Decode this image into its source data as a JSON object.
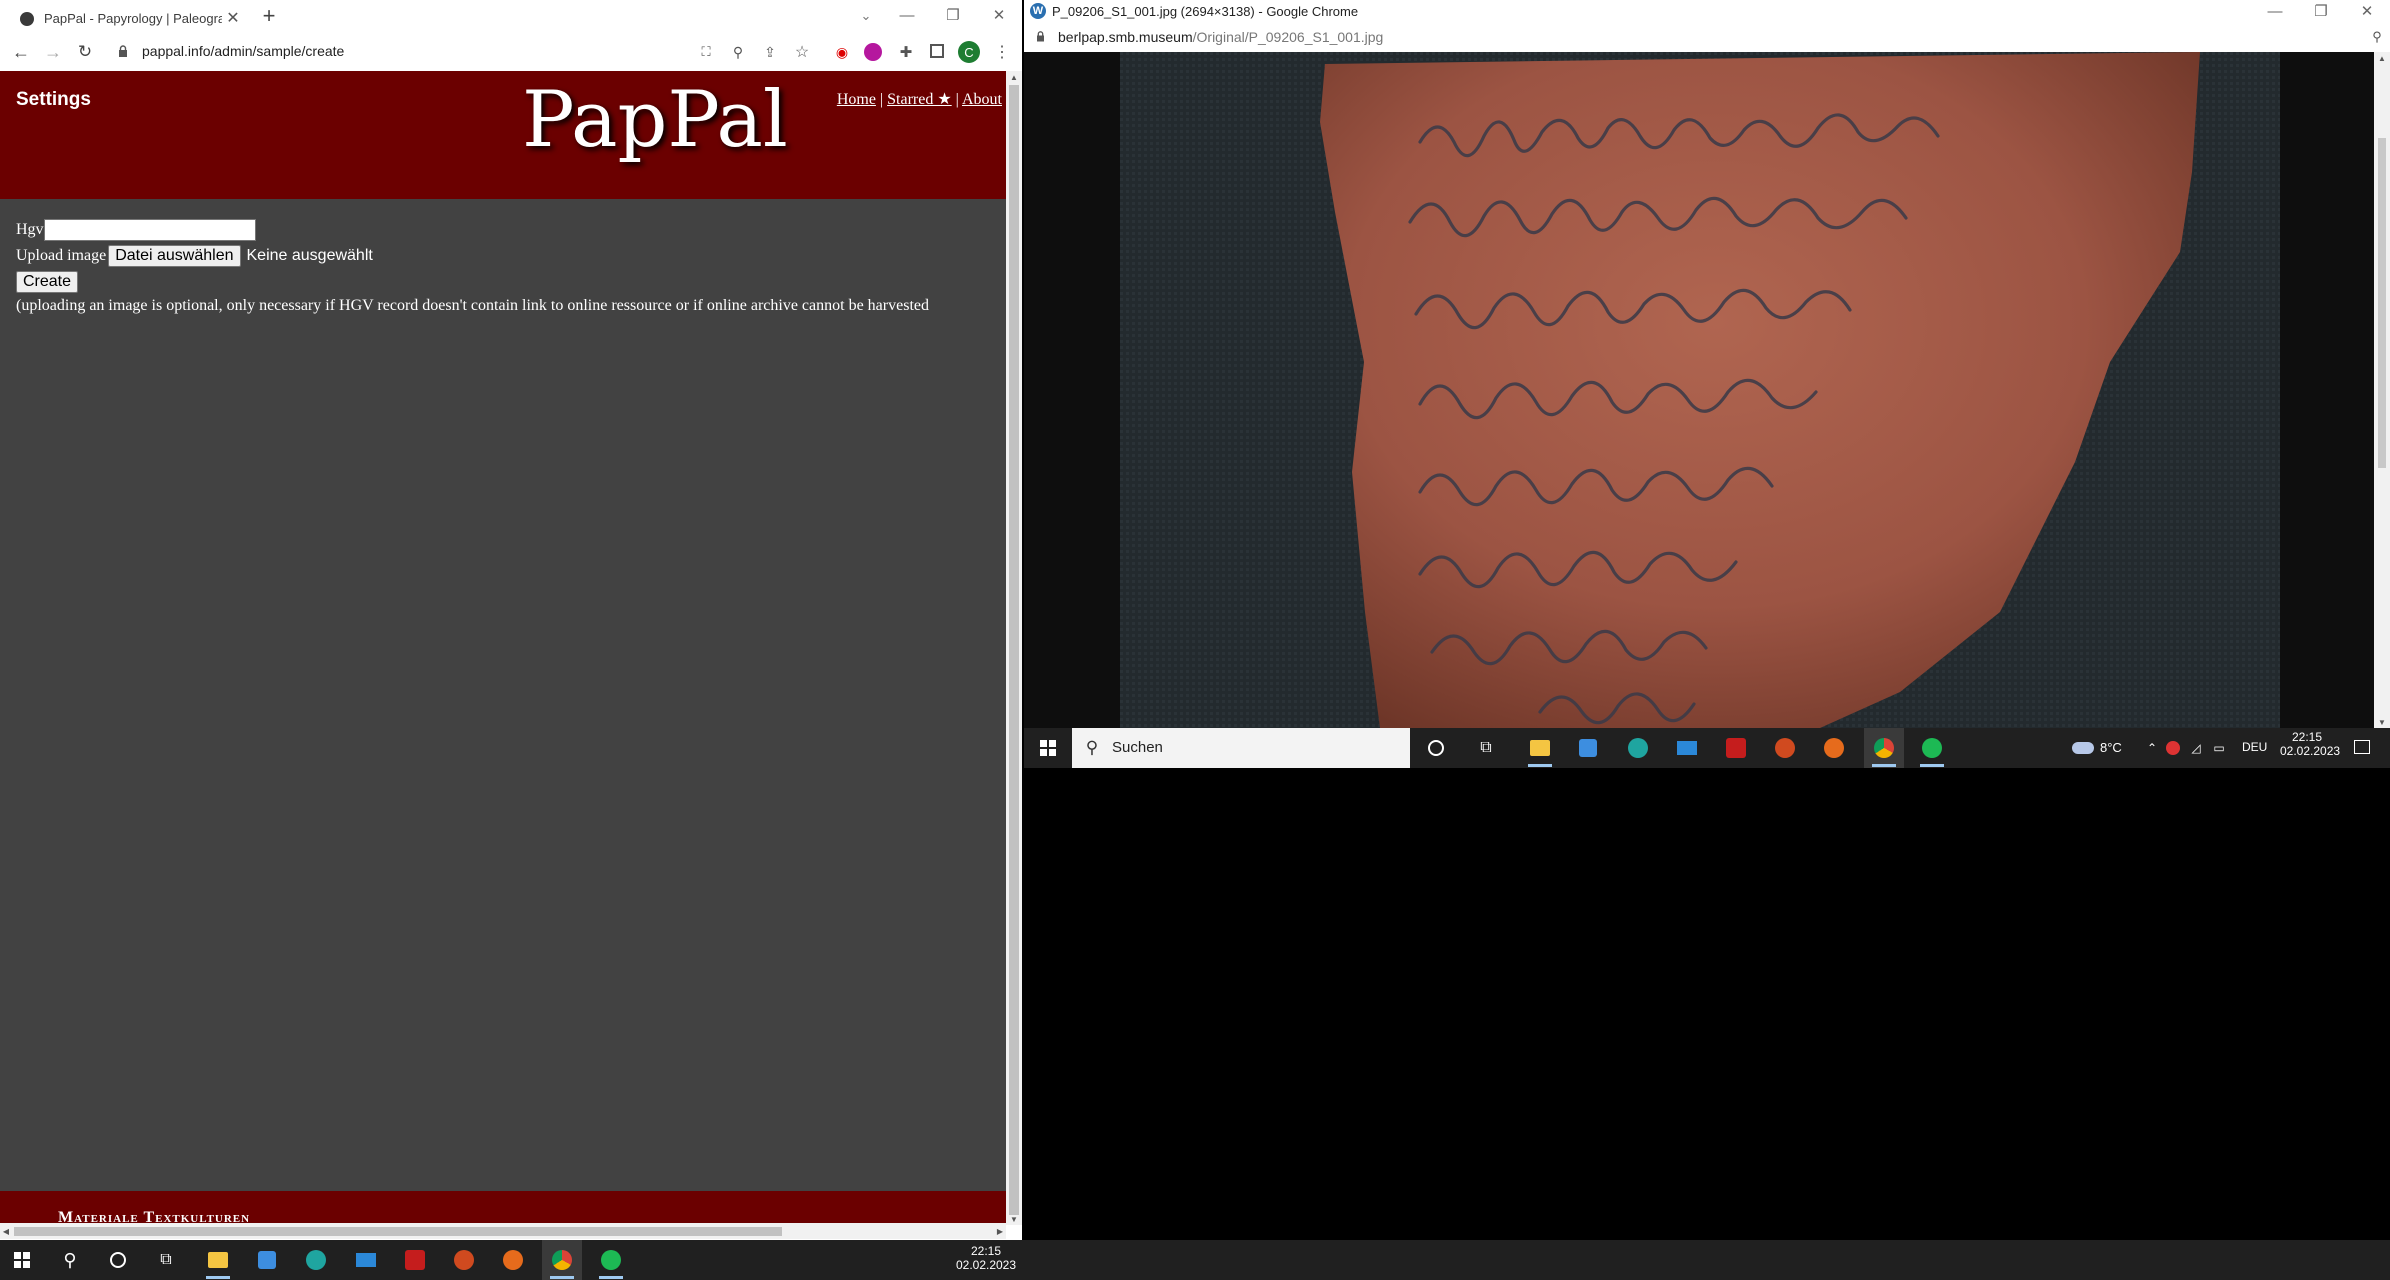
{
  "left_browser": {
    "tab_title": "PapPal - Papyrology | Paleograph",
    "url": "pappal.info/admin/sample/create",
    "site": {
      "settings_label": "Settings",
      "logo": "PapPal",
      "nav": {
        "home": "Home",
        "sep1": "|",
        "starred": "Starred ★",
        "sep2": "|",
        "about": "About"
      },
      "form": {
        "hgv_label": "Hgv",
        "hgv_value": "",
        "upload_label": "Upload image",
        "file_button": "Datei auswählen",
        "file_status": "Keine ausgewählt",
        "create_button": "Create"
      },
      "note": "(uploading an image is optional, only necessary if HGV record doesn't contain link to online ressource or if online archive cannot be harvested",
      "footer_text": "Materiale Textkulturen"
    },
    "colors": {
      "header_bg": "#6b0000",
      "page_bg": "#424242"
    }
  },
  "right_browser": {
    "window_title": "P_09206_S1_001.jpg (2694×3138) - Google Chrome",
    "url_domain": "berlpap.smb.museum",
    "url_path": "/Original/P_09206_S1_001.jpg",
    "image_desc_icon": "ostracon-image"
  },
  "right_taskbar": {
    "search_placeholder": "Suchen",
    "weather": "8°C",
    "language": "DEU",
    "time": "22:15",
    "date": "02.02.2023"
  },
  "taskbar": {
    "time": "22:15",
    "date": "02.02.2023"
  }
}
